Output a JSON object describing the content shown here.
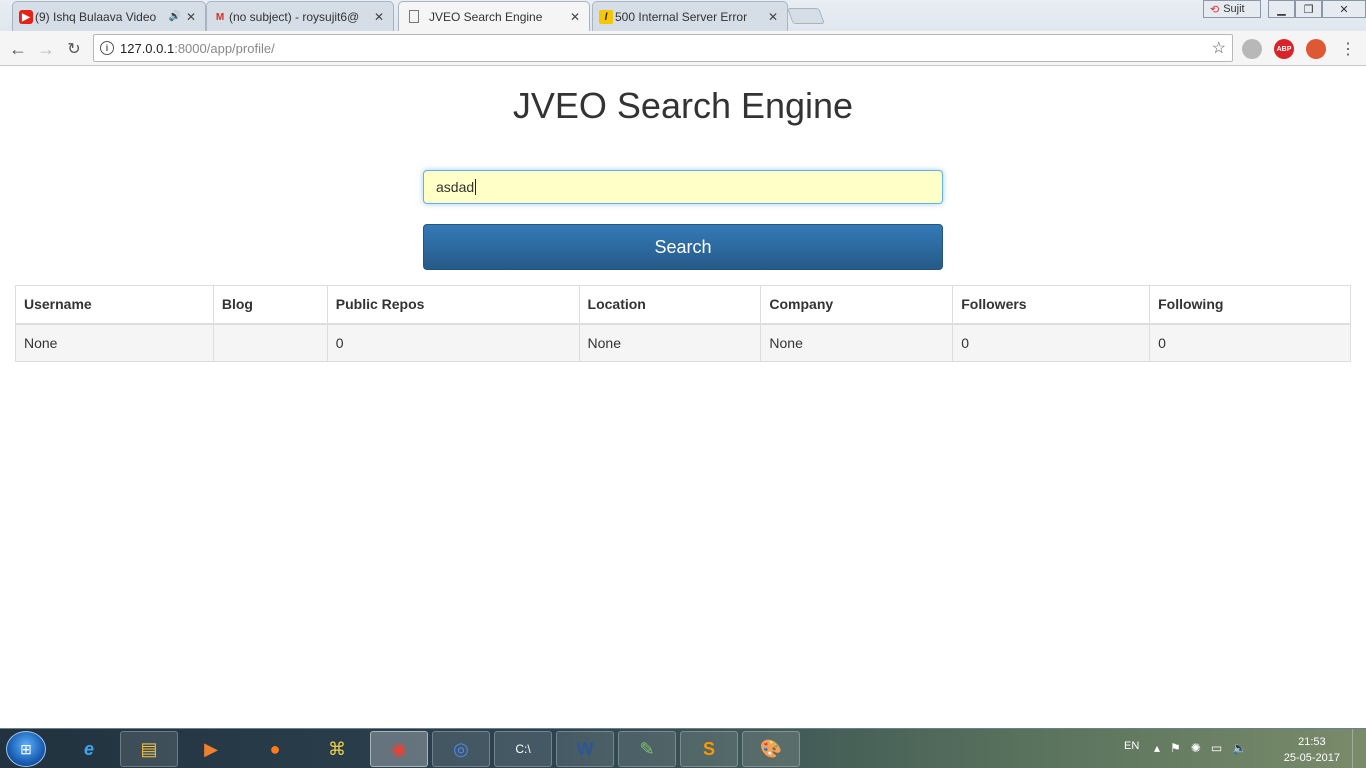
{
  "browser": {
    "tabs": [
      {
        "title": "(9) Ishq Bulaava Video",
        "favicon": "youtube-icon",
        "has_audio": true
      },
      {
        "title": "(no subject) - roysujit6@",
        "favicon": "gmail-icon"
      },
      {
        "title": "JVEO Search Engine",
        "favicon": "page-icon",
        "active": true
      },
      {
        "title": "500 Internal Server Error",
        "favicon": "error-icon"
      }
    ],
    "user_name": "Sujit",
    "address": {
      "host": "127.0.0.1",
      "path": ":8000/app/profile/"
    },
    "extensions": [
      "shield-icon",
      "adblock-icon",
      "duckduckgo-icon"
    ]
  },
  "page": {
    "title": "JVEO Search Engine",
    "search_value": "asdad",
    "search_button": "Search",
    "table": {
      "headers": [
        "Username",
        "Blog",
        "Public Repos",
        "Location",
        "Company",
        "Followers",
        "Following"
      ],
      "rows": [
        [
          "None",
          "",
          "0",
          "None",
          "None",
          "0",
          "0"
        ]
      ]
    }
  },
  "taskbar": {
    "apps": [
      "internet-explorer-icon",
      "file-explorer-icon",
      "media-player-icon",
      "firefox-icon",
      "python-icon",
      "chrome-icon",
      "chromium-icon",
      "cmd-icon",
      "word-icon",
      "notepad-plus-icon",
      "sublime-icon",
      "paint-icon"
    ],
    "language": "EN",
    "time": "21:53",
    "date": "25-05-2017"
  },
  "colors": {
    "accent": "#337ab7",
    "input_bg": "#ffffc8"
  }
}
